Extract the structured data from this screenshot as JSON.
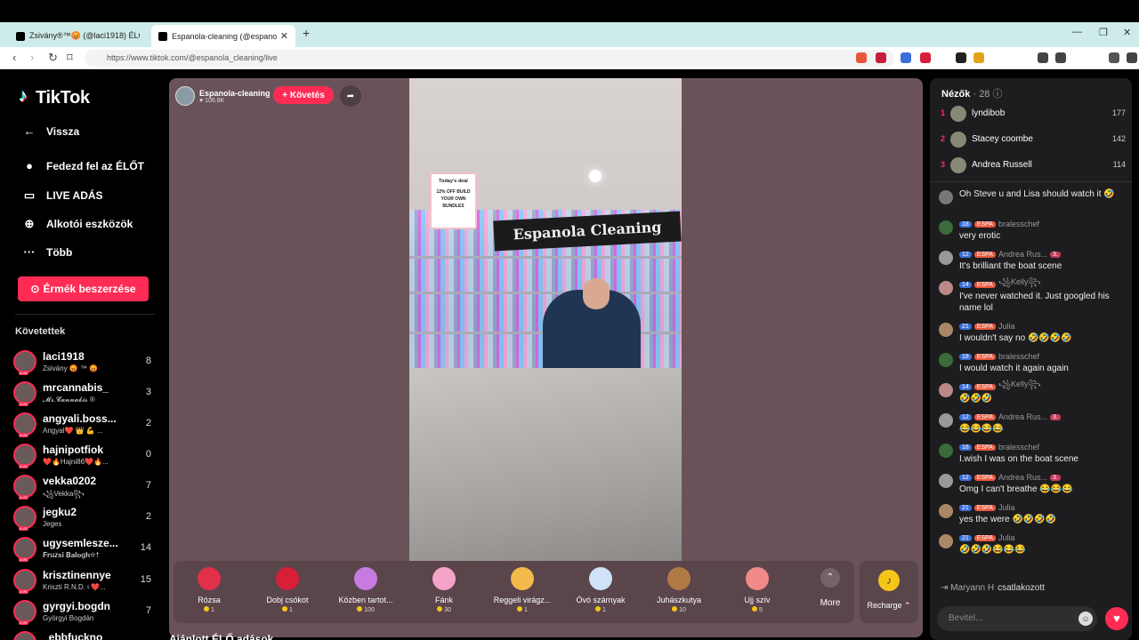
{
  "browser": {
    "tabs": [
      {
        "title": "Zsivány®™😡 (@laci1918) ÉLŐ ..."
      },
      {
        "title": "Espanola-cleaning (@espanola_..."
      }
    ],
    "url": "https://www.tiktok.com/@espanola_cleaning/live"
  },
  "sidebar": {
    "logo": "TikTok",
    "back": "Vissza",
    "nav": [
      {
        "label": "Fedezd fel az ÉLŐT",
        "icon": "live-avatar-icon"
      },
      {
        "label": "LIVE ADÁS",
        "icon": "camera-icon"
      },
      {
        "label": "Alkotói eszközök",
        "icon": "add-icon"
      },
      {
        "label": "Több",
        "icon": "more-icon"
      }
    ],
    "coins_button": "Érmék beszerzése",
    "following_title": "Követettek",
    "following": [
      {
        "name": "laci1918",
        "sub": "Zsivány 😡 ™ 😡",
        "count": "8"
      },
      {
        "name": "mrcannabis_",
        "sub": "𝓜𝓻.𝓒𝓪𝓷𝓷𝓪𝓫𝓲𝓼 ®",
        "count": "3"
      },
      {
        "name": "angyali.boss...",
        "sub": "Angyal❤️ 👑 💪 ...",
        "count": "2"
      },
      {
        "name": "hajnipotfiok",
        "sub": "❤️🔥Hajni86❤️🔥...",
        "count": "0"
      },
      {
        "name": "vekka0202",
        "sub": "꧁Vekka꧂",
        "count": "7"
      },
      {
        "name": "jegku2",
        "sub": "Jeges",
        "count": "2"
      },
      {
        "name": "ugysemlesze...",
        "sub": "𝐅𝐫𝐮𝐳𝐬𝐢 𝐁𝐚𝐥𝐨𝐠𝐡☆†",
        "count": "14"
      },
      {
        "name": "krisztinennye",
        "sub": "Kriszti R.N.D.♀❤️...",
        "count": "15"
      },
      {
        "name": "gyrgyi.bogdn",
        "sub": "Györgyi Bogdán",
        "count": "7"
      },
      {
        "name": "_ebbfuckno",
        "sub": "",
        "count": ""
      }
    ]
  },
  "stage": {
    "host_name": "Espanola-cleaning",
    "host_likes": "106.8K",
    "follow_button": "+ Követés",
    "deal_title": "Today's deal",
    "deal_text": "12% OFF BUILD YOUR OWN BUNDLES",
    "store_sign": "Espanola Cleaning",
    "gifts": [
      {
        "name": "Rózsa",
        "price": "1",
        "color": "#e0304a"
      },
      {
        "name": "Dobj csókot",
        "price": "1",
        "color": "#d81f3a"
      },
      {
        "name": "Közben tartot...",
        "price": "100",
        "color": "#c77be0"
      },
      {
        "name": "Fánk",
        "price": "30",
        "color": "#f5a3c7"
      },
      {
        "name": "Reggeli virágz...",
        "price": "1",
        "color": "#f3b94a"
      },
      {
        "name": "Óvó szárnyak",
        "price": "1",
        "color": "#cfe2f7"
      },
      {
        "name": "Juhászkutya",
        "price": "10",
        "color": "#b07a45"
      },
      {
        "name": "Ujj szív",
        "price": "5",
        "color": "#f08a8a"
      }
    ],
    "more_label": "More",
    "recharge_label": "Recharge ⌃",
    "recommended_title": "Ajánlott ÉLŐ adások"
  },
  "chat": {
    "viewers_label": "Nézők",
    "viewers_count": "· 28",
    "top_viewers": [
      {
        "rank": "1",
        "name": "lyndibob",
        "score": "177"
      },
      {
        "rank": "2",
        "name": "Stacey coombe",
        "score": "142"
      },
      {
        "rank": "3",
        "name": "Andrea Russell",
        "score": "114"
      }
    ],
    "messages": [
      {
        "level": "",
        "fan": "",
        "user": "",
        "rank": "",
        "text": "Oh Steve u and Lisa should watch it 🤣"
      },
      {
        "level": "18",
        "fan": "ESPA",
        "user": "bralesschef",
        "rank": "",
        "text": "very erotic"
      },
      {
        "level": "12",
        "fan": "ESPA",
        "user": "Andrea Rus...",
        "rank": "3.",
        "text": "It's brilliant the boat scene"
      },
      {
        "level": "14",
        "fan": "ESPA",
        "user": "꧁Kelly꧂",
        "rank": "",
        "text": "I've never watched it. Just googled his name lol"
      },
      {
        "level": "21",
        "fan": "ESPA",
        "user": "Julia",
        "rank": "",
        "text": "I wouldn't say no 🤣🤣🤣🤣"
      },
      {
        "level": "18",
        "fan": "ESPA",
        "user": "bralesschef",
        "rank": "",
        "text": "I would watch it again again"
      },
      {
        "level": "14",
        "fan": "ESPA",
        "user": "꧁Kelly꧂",
        "rank": "",
        "text": "🤣🤣🤣"
      },
      {
        "level": "12",
        "fan": "ESPA",
        "user": "Andrea Rus...",
        "rank": "3.",
        "text": "😂😂😂😂"
      },
      {
        "level": "18",
        "fan": "ESPA",
        "user": "bralesschef",
        "rank": "",
        "text": "I.wish I was on the boat scene"
      },
      {
        "level": "12",
        "fan": "ESPA",
        "user": "Andrea Rus...",
        "rank": "3.",
        "text": "Omg I can't breathe 😂😂😂"
      },
      {
        "level": "21",
        "fan": "ESPA",
        "user": "Julia",
        "rank": "",
        "text": "yes the were 🤣🤣🤣🤣"
      },
      {
        "level": "21",
        "fan": "ESPA",
        "user": "Julia",
        "rank": "",
        "text": "🤣🤣🤣😂😂😂"
      }
    ],
    "joined_user": "Maryann H",
    "joined_text": "csatlakozott",
    "input_placeholder": "Bevitel..."
  }
}
